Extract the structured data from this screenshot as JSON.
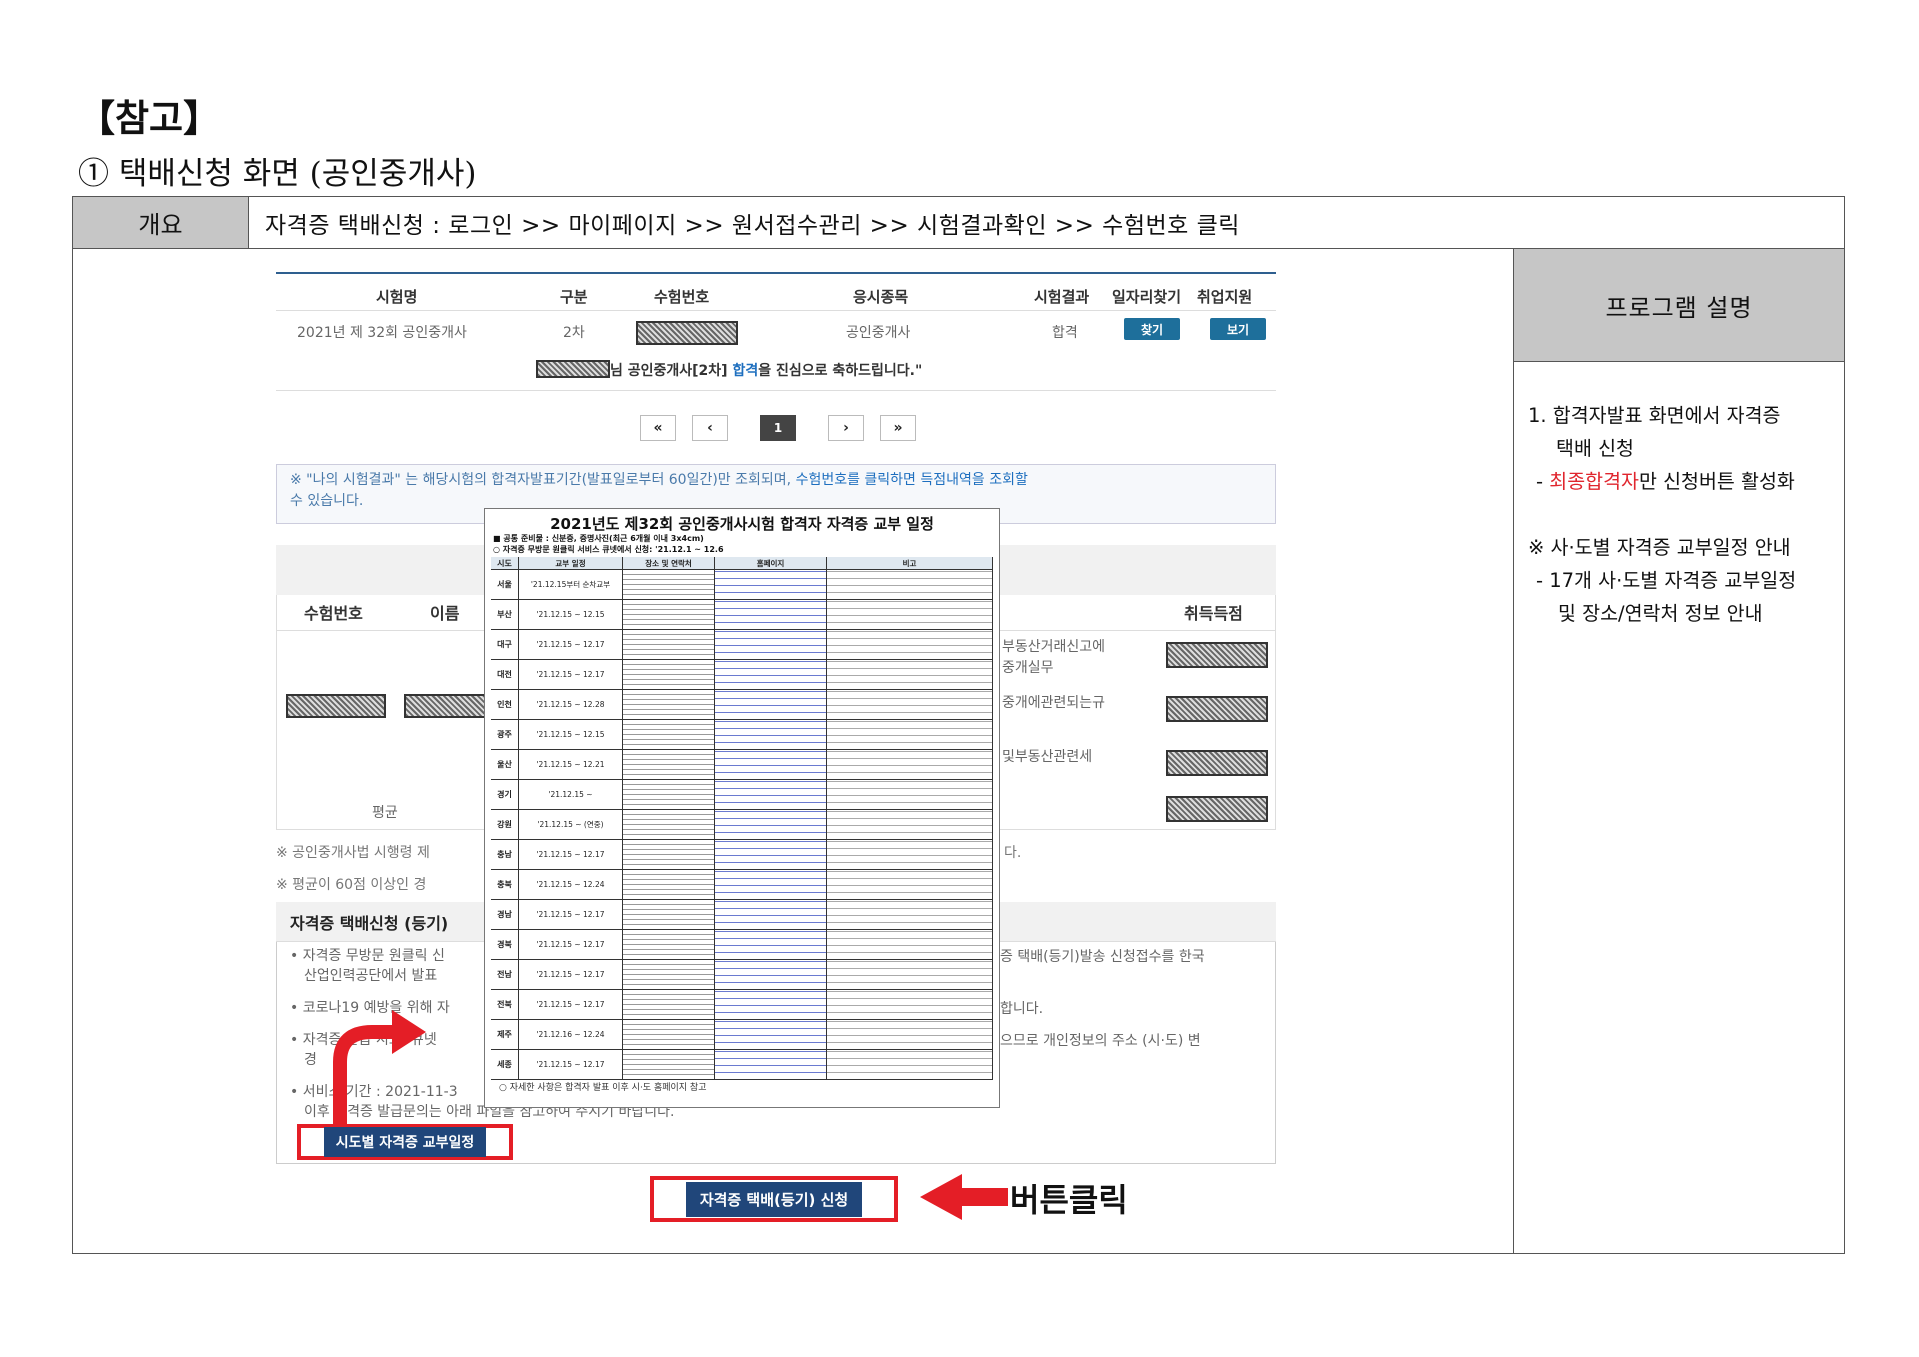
{
  "heading": "【참고】",
  "subheading": "① 택배신청 화면 (공인중개사)",
  "overview": {
    "label": "개요",
    "value": "자격증 택배신청 : 로그인 >> 마이페이지 >> 원서접수관리 >> 시험결과확인 >> 수험번호 클릭"
  },
  "program": {
    "title": "프로그램 설명",
    "item1_line1": "1. 합격자발표 화면에서 자격증",
    "item1_line2": "택배 신청",
    "item1_sub_red": "최종합격자",
    "item1_sub_rest": "만 신청버튼 활성화",
    "item2_line1": "※ 사·도별 자격증 교부일정 안내",
    "item2_sub1": "- 17개 사·도별 자격증 교부일정",
    "item2_sub2": "및 장소/연락처 정보 안내",
    "dash": "-"
  },
  "screen": {
    "headers": {
      "exam": "시험명",
      "round": "구분",
      "number": "수험번호",
      "type": "응시종목",
      "result": "시험결과",
      "job": "일자리찾기",
      "support": "취업지원"
    },
    "row": {
      "exam": "2021년 제 32회 공인중개사",
      "round": "2차",
      "type": "공인중개사",
      "result": "합격",
      "job_btn": "찾기",
      "support_btn": "보기"
    },
    "congrats_pre": "님 공인중개사[2차] ",
    "congrats_blue": "합격",
    "congrats_post": "을 진심으로 축하드립니다.\"",
    "pager": [
      "«",
      "‹",
      "1",
      "›",
      "»"
    ],
    "notice_pre": "※ \"나의 시험결과\" 는 해당시험의 합격자발표기간(발표일로부터 60일간)만 조회되며, ",
    "notice_blue": "수험번호를 클릭하면 득점내역을 조회할",
    "notice_line2": "수 있습니다.",
    "score_headers": {
      "number": "수험번호",
      "name": "이름",
      "score": "취득득점"
    },
    "score_rows": [
      "부동산거래신고에",
      "중개실무",
      "중개에관련되는규",
      "및부동산관련세"
    ],
    "average": "평균",
    "law_note": "※ 공인중개사법 시행령 제",
    "law_note_tail": "다.",
    "avg_note": "※ 평균이 60점 이상인 경",
    "shipping": {
      "title": "자격증 택배신청 (등기)",
      "b1a": "• 자격증 무방문 원클릭 신",
      "b1b": "산업인력공단에서 발표",
      "b1r": "증 택배(등기)발송 신청접수를 한국",
      "b2": "• 코로나19 예방을 위해 자",
      "b2r": "합니다.",
      "b3": "• 자격증 발급 시도: 큐넷",
      "b3b": "경",
      "b3r": "으므로 개인정보의 주소 (시·도) 변",
      "b4": "• 서비스 기간 : 2021-11-3",
      "b4b": "이후 자격증 발급문의는 아래 파일을 참고하여 주시기 바랍니다."
    },
    "btn_city": "시도별 자격증 교부일정",
    "btn_apply": "자격증 택배(등기) 신청",
    "click_label": "버튼클릭"
  },
  "schedule_popup": {
    "title": "2021년도 제32회 공인중개사시험 합격자 자격증 교부 일정",
    "line1": "■ 공통 준비물 : 신분증, 증명사진(최근 6개월 이내 3x4cm)",
    "line2": "○ 자격증 무방문 원클릭 서비스 큐넷에서 신청: '21.12.1 ~ 12.6",
    "head": [
      "시도",
      "교부 일정",
      "장소 및 연락처",
      "홈페이지",
      "비고"
    ],
    "regions": [
      "서울",
      "부산",
      "대구",
      "대전",
      "인천",
      "광주",
      "울산",
      "경기",
      "강원",
      "충남",
      "충북",
      "경남",
      "경북",
      "전남",
      "전북",
      "제주",
      "세종"
    ],
    "dates": [
      "'21.12.15부터 순차교부",
      "'21.12.15 ~ 12.15",
      "'21.12.15 ~ 12.17",
      "'21.12.15 ~ 12.17",
      "'21.12.15 ~ 12.28",
      "'21.12.15 ~ 12.15",
      "'21.12.15 ~ 12.21",
      "'21.12.15 ~",
      "'21.12.15 ~ (연중)",
      "'21.12.15 ~ 12.17",
      "'21.12.15 ~ 12.24",
      "'21.12.15 ~ 12.17",
      "'21.12.15 ~ 12.17",
      "'21.12.15 ~ 12.17",
      "'21.12.15 ~ 12.17",
      "'21.12.16 ~ 12.24",
      "'21.12.15 ~ 12.17"
    ],
    "foot": "○ 자세한 사항은 합격자 발표 이후 시·도 홈페이지 참고"
  }
}
